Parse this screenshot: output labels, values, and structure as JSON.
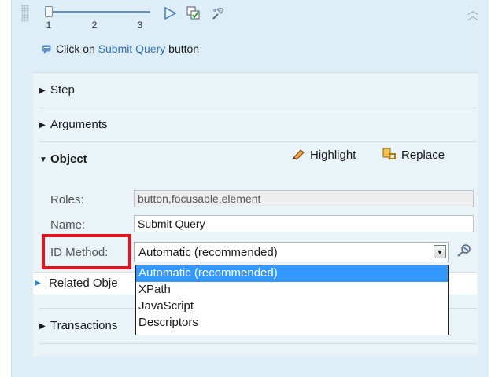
{
  "toolbar": {
    "slider_ticks": [
      "1",
      "2",
      "3"
    ],
    "slider_value": 1
  },
  "step_message": {
    "prefix": "Click on",
    "link": "Submit Query",
    "suffix": "button"
  },
  "sections": {
    "step": "Step",
    "arguments": "Arguments",
    "object": "Object",
    "related": "Related Obje",
    "transactions": "Transactions"
  },
  "object_tools": {
    "highlight": "Highlight",
    "replace": "Replace"
  },
  "fields": {
    "roles_label": "Roles:",
    "roles_value": "button,focusable,element",
    "name_label": "Name:",
    "name_value": "Submit Query",
    "id_method_label": "ID Method:",
    "id_method_value": "Automatic (recommended)"
  },
  "dropdown_options": [
    "Automatic (recommended)",
    "XPath",
    "JavaScript",
    "Descriptors"
  ],
  "colors": {
    "panel_bg": "#ddeef6",
    "link": "#2f6fb4",
    "selection": "#3399ff",
    "highlight_frame": "#e0141e"
  }
}
